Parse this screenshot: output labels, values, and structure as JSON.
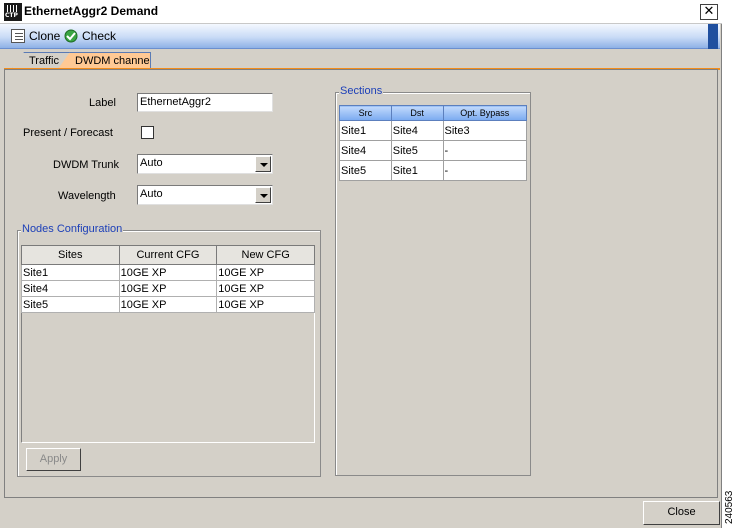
{
  "window": {
    "title": "EthernetAggr2 Demand",
    "logo_text": "CTP",
    "close_glyph": "✕"
  },
  "toolbar": {
    "clone_label": "Clone",
    "check_label": "Check"
  },
  "tabs": [
    {
      "label": "Traffic",
      "active": false
    },
    {
      "label": "DWDM channel",
      "active": true
    }
  ],
  "form": {
    "label_caption": "Label",
    "label_value": "EthernetAggr2",
    "present_forecast_caption": "Present / Forecast",
    "present_forecast_checked": false,
    "dwdm_trunk_caption": "DWDM Trunk",
    "dwdm_trunk_value": "Auto",
    "wavelength_caption": "Wavelength",
    "wavelength_value": "Auto"
  },
  "nodes_configuration": {
    "title": "Nodes Configuration",
    "columns": [
      "Sites",
      "Current CFG",
      "New CFG"
    ],
    "rows": [
      [
        "Site1",
        "10GE XP",
        "10GE XP"
      ],
      [
        "Site4",
        "10GE XP",
        "10GE XP"
      ],
      [
        "Site5",
        "10GE XP",
        "10GE XP"
      ]
    ],
    "apply_label": "Apply"
  },
  "sections": {
    "title": "Sections",
    "columns": [
      "Src",
      "Dst",
      "Opt. Bypass"
    ],
    "rows": [
      [
        "Site1",
        "Site4",
        "Site3"
      ],
      [
        "Site4",
        "Site5",
        "-"
      ],
      [
        "Site5",
        "Site1",
        "-"
      ]
    ]
  },
  "footer": {
    "close_label": "Close",
    "figure_id": "240563"
  },
  "colors": {
    "accent_tab": "#ffc994",
    "tab_underline": "#f28c1b",
    "group_title": "#1c3fb8",
    "toolbar_gradient_bottom": "#8eb1e6"
  }
}
